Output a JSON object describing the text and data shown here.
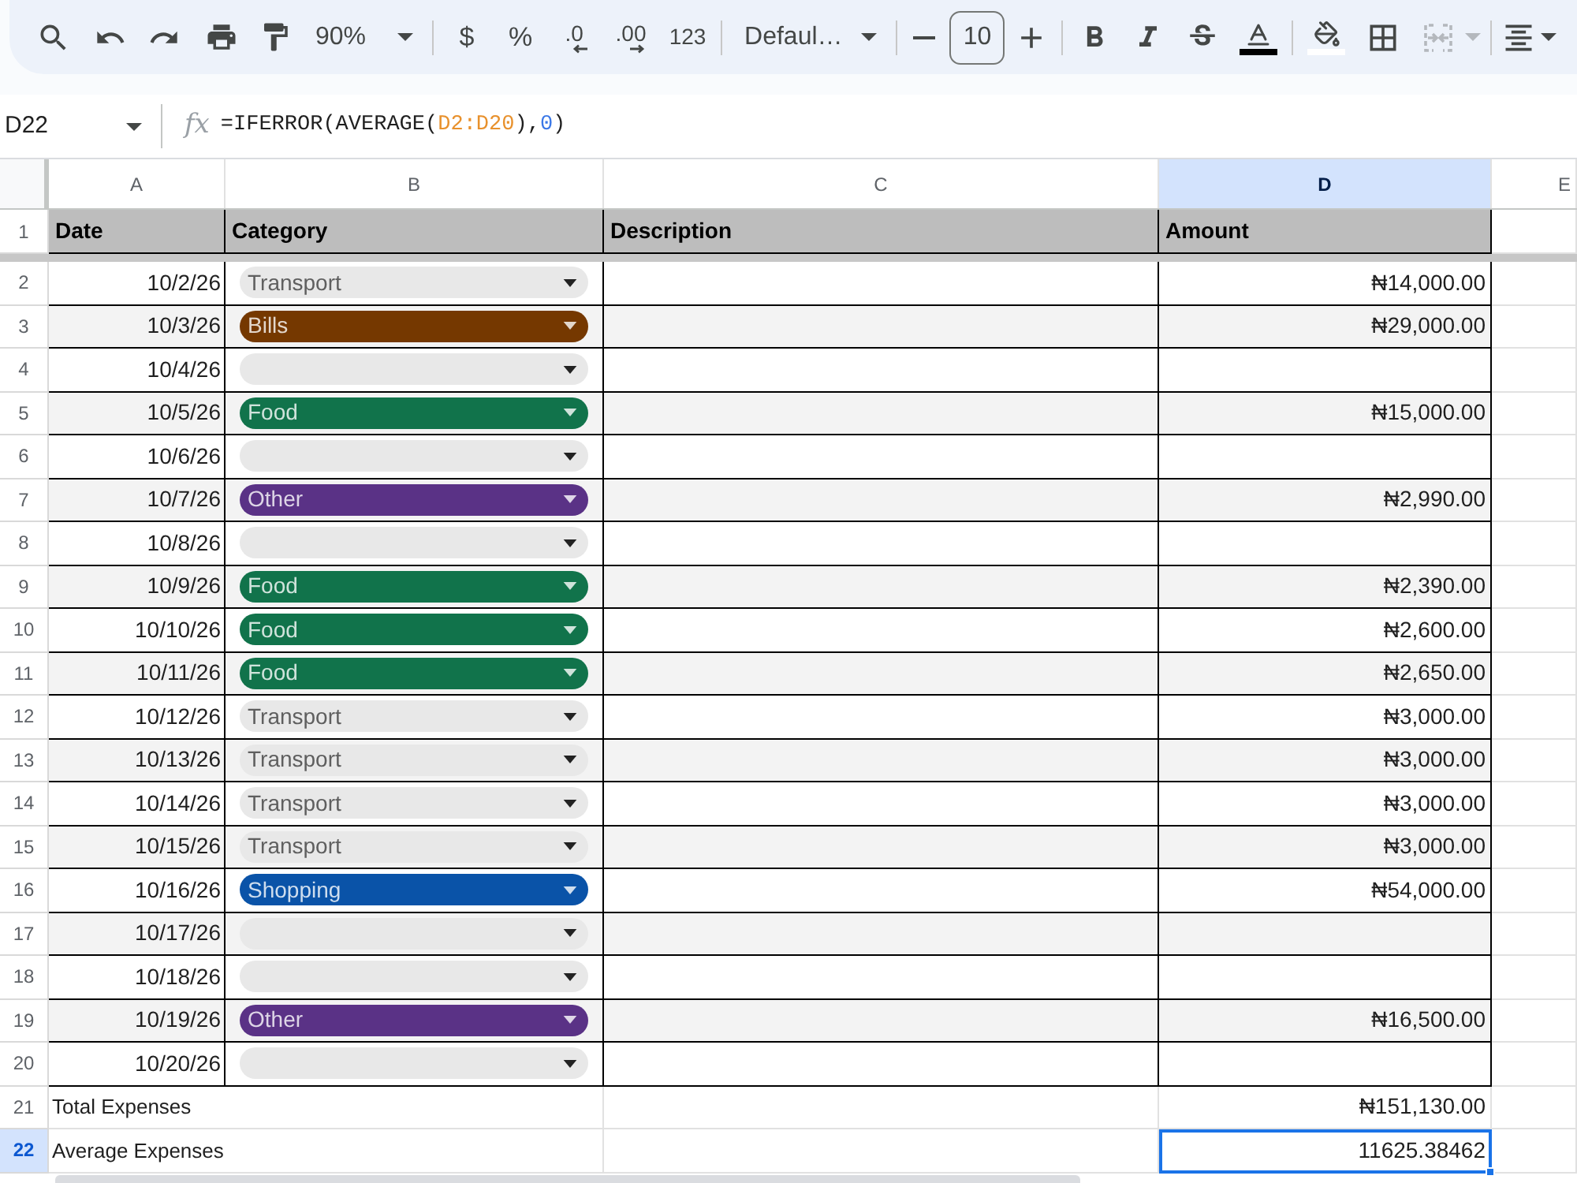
{
  "toolbar": {
    "zoom": "90%",
    "currency": "$",
    "percent": "%",
    "decrease_decimals": ".0",
    "increase_decimals": ".00",
    "number_formats": "123",
    "font": "Defaul…",
    "font_size": "10",
    "color_tools": [
      {
        "kind": "text_color",
        "color": "#000000"
      },
      {
        "kind": "fill_color",
        "color": "#ffffff"
      }
    ],
    "merge_disabled": true
  },
  "formula_bar": {
    "cell_reference": "D22",
    "function_label": "fx",
    "formula": [
      {
        "kind": "plain",
        "text": "=IFERROR(AVERAGE("
      },
      {
        "kind": "range",
        "text": "D2:D20"
      },
      {
        "kind": "plain",
        "text": "),"
      },
      {
        "kind": "number",
        "text": "0"
      },
      {
        "kind": "plain",
        "text": ")"
      }
    ]
  },
  "columns": [
    {
      "label": "A",
      "selected": false
    },
    {
      "label": "B",
      "selected": false
    },
    {
      "label": "C",
      "selected": false
    },
    {
      "label": "D",
      "selected": true
    },
    {
      "label": "E",
      "selected": false
    }
  ],
  "header_row": {
    "row": "1",
    "cells": [
      "Date",
      "Category",
      "Description",
      "Amount"
    ]
  },
  "rows": [
    {
      "row": "2",
      "date": "10/2/26",
      "category": {
        "label": "Transport",
        "color": "#e8e8e8"
      },
      "amount": "₦14,000.00"
    },
    {
      "row": "3",
      "date": "10/3/26",
      "category": {
        "label": "Bills",
        "color": "#753800"
      },
      "amount": "₦29,000.00"
    },
    {
      "row": "4",
      "date": "10/4/26",
      "category": {
        "color": "#e8e8e8"
      }
    },
    {
      "row": "5",
      "date": "10/5/26",
      "category": {
        "label": "Food",
        "color": "#11734b"
      },
      "amount": "₦15,000.00"
    },
    {
      "row": "6",
      "date": "10/6/26",
      "category": {
        "color": "#e8e8e8"
      }
    },
    {
      "row": "7",
      "date": "10/7/26",
      "category": {
        "label": "Other",
        "color": "#5a3286"
      },
      "amount": "₦2,990.00"
    },
    {
      "row": "8",
      "date": "10/8/26",
      "category": {
        "color": "#e8e8e8"
      }
    },
    {
      "row": "9",
      "date": "10/9/26",
      "category": {
        "label": "Food",
        "color": "#11734b"
      },
      "amount": "₦2,390.00"
    },
    {
      "row": "10",
      "date": "10/10/26",
      "category": {
        "label": "Food",
        "color": "#11734b"
      },
      "amount": "₦2,600.00"
    },
    {
      "row": "11",
      "date": "10/11/26",
      "category": {
        "label": "Food",
        "color": "#11734b"
      },
      "amount": "₦2,650.00"
    },
    {
      "row": "12",
      "date": "10/12/26",
      "category": {
        "label": "Transport",
        "color": "#e8e8e8"
      },
      "amount": "₦3,000.00"
    },
    {
      "row": "13",
      "date": "10/13/26",
      "category": {
        "label": "Transport",
        "color": "#e8e8e8"
      },
      "amount": "₦3,000.00"
    },
    {
      "row": "14",
      "date": "10/14/26",
      "category": {
        "label": "Transport",
        "color": "#e8e8e8"
      },
      "amount": "₦3,000.00"
    },
    {
      "row": "15",
      "date": "10/15/26",
      "category": {
        "label": "Transport",
        "color": "#e8e8e8"
      },
      "amount": "₦3,000.00"
    },
    {
      "row": "16",
      "date": "10/16/26",
      "category": {
        "label": "Shopping",
        "color": "#0a53a8"
      },
      "amount": "₦54,000.00"
    },
    {
      "row": "17",
      "date": "10/17/26",
      "category": {
        "color": "#e8e8e8"
      }
    },
    {
      "row": "18",
      "date": "10/18/26",
      "category": {
        "color": "#e8e8e8"
      }
    },
    {
      "row": "19",
      "date": "10/19/26",
      "category": {
        "label": "Other",
        "color": "#5a3286"
      },
      "amount": "₦16,500.00"
    },
    {
      "row": "20",
      "date": "10/20/26",
      "category": {
        "color": "#e8e8e8"
      }
    }
  ],
  "summary_rows": [
    {
      "row": "21",
      "label": "Total Expenses",
      "amount": "₦151,130.00",
      "selected": false
    },
    {
      "row": "22",
      "label": "Average Expenses",
      "amount": "11625.38462",
      "selected": true
    }
  ]
}
